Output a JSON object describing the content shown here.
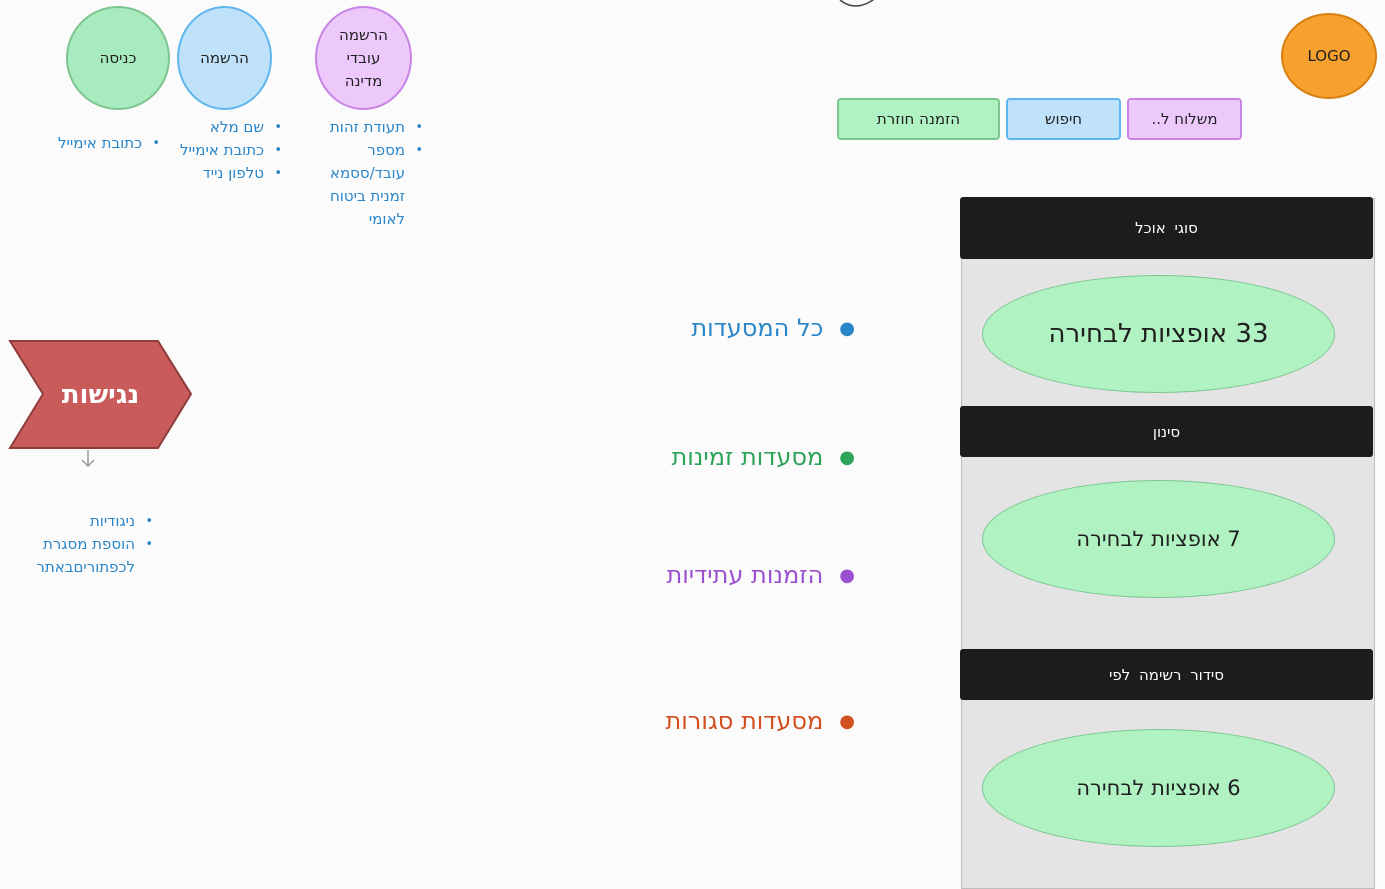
{
  "top_circles": {
    "entry": "כניסה",
    "register": "הרשמה",
    "state_register": "הרשמה עובדי מדינה"
  },
  "entry_fields": [
    "כתובת אימייל"
  ],
  "register_fields": [
    "שם מלא",
    "כתובת אימייל",
    "טלפון נייד"
  ],
  "state_register_fields": [
    "תעודת זהות",
    "מספר עובד/ססמא זמנית ביטוח לאומי"
  ],
  "logo": "LOGO",
  "nav_buttons": {
    "delivery": "משלוח ל..",
    "search": "חיפוש",
    "reorder": "הזמנה חוזרת"
  },
  "accessibility": {
    "label": "נגישות",
    "items": [
      "ניגודיות",
      "הוספת מסגרת לכפתוריםבאתר"
    ]
  },
  "categories": [
    {
      "label": "כל המסעדות",
      "color": "#2a86c9"
    },
    {
      "label": "מסעדות זמינות",
      "color": "#2ea35a"
    },
    {
      "label": "הזמנות עתידיות",
      "color": "#9b4fd1"
    },
    {
      "label": "מסעדות סגורות",
      "color": "#d2501f"
    }
  ],
  "panel": {
    "food_types_title": "סוגי אוכל",
    "food_types_options": "33 אופציות לבחירה",
    "filter_title": "סינון",
    "filter_options": "7 אופציות לבחירה",
    "sort_title": "סידור רשימה לפי",
    "sort_options": "6 אופציות לבחירה"
  },
  "colors": {
    "circle_green": "#a8ebbe",
    "circle_blue": "#bfe2fa",
    "circle_purple": "#edc9fb",
    "logo_orange": "#f6a02d",
    "accessibility_red": "#c95b5b"
  }
}
